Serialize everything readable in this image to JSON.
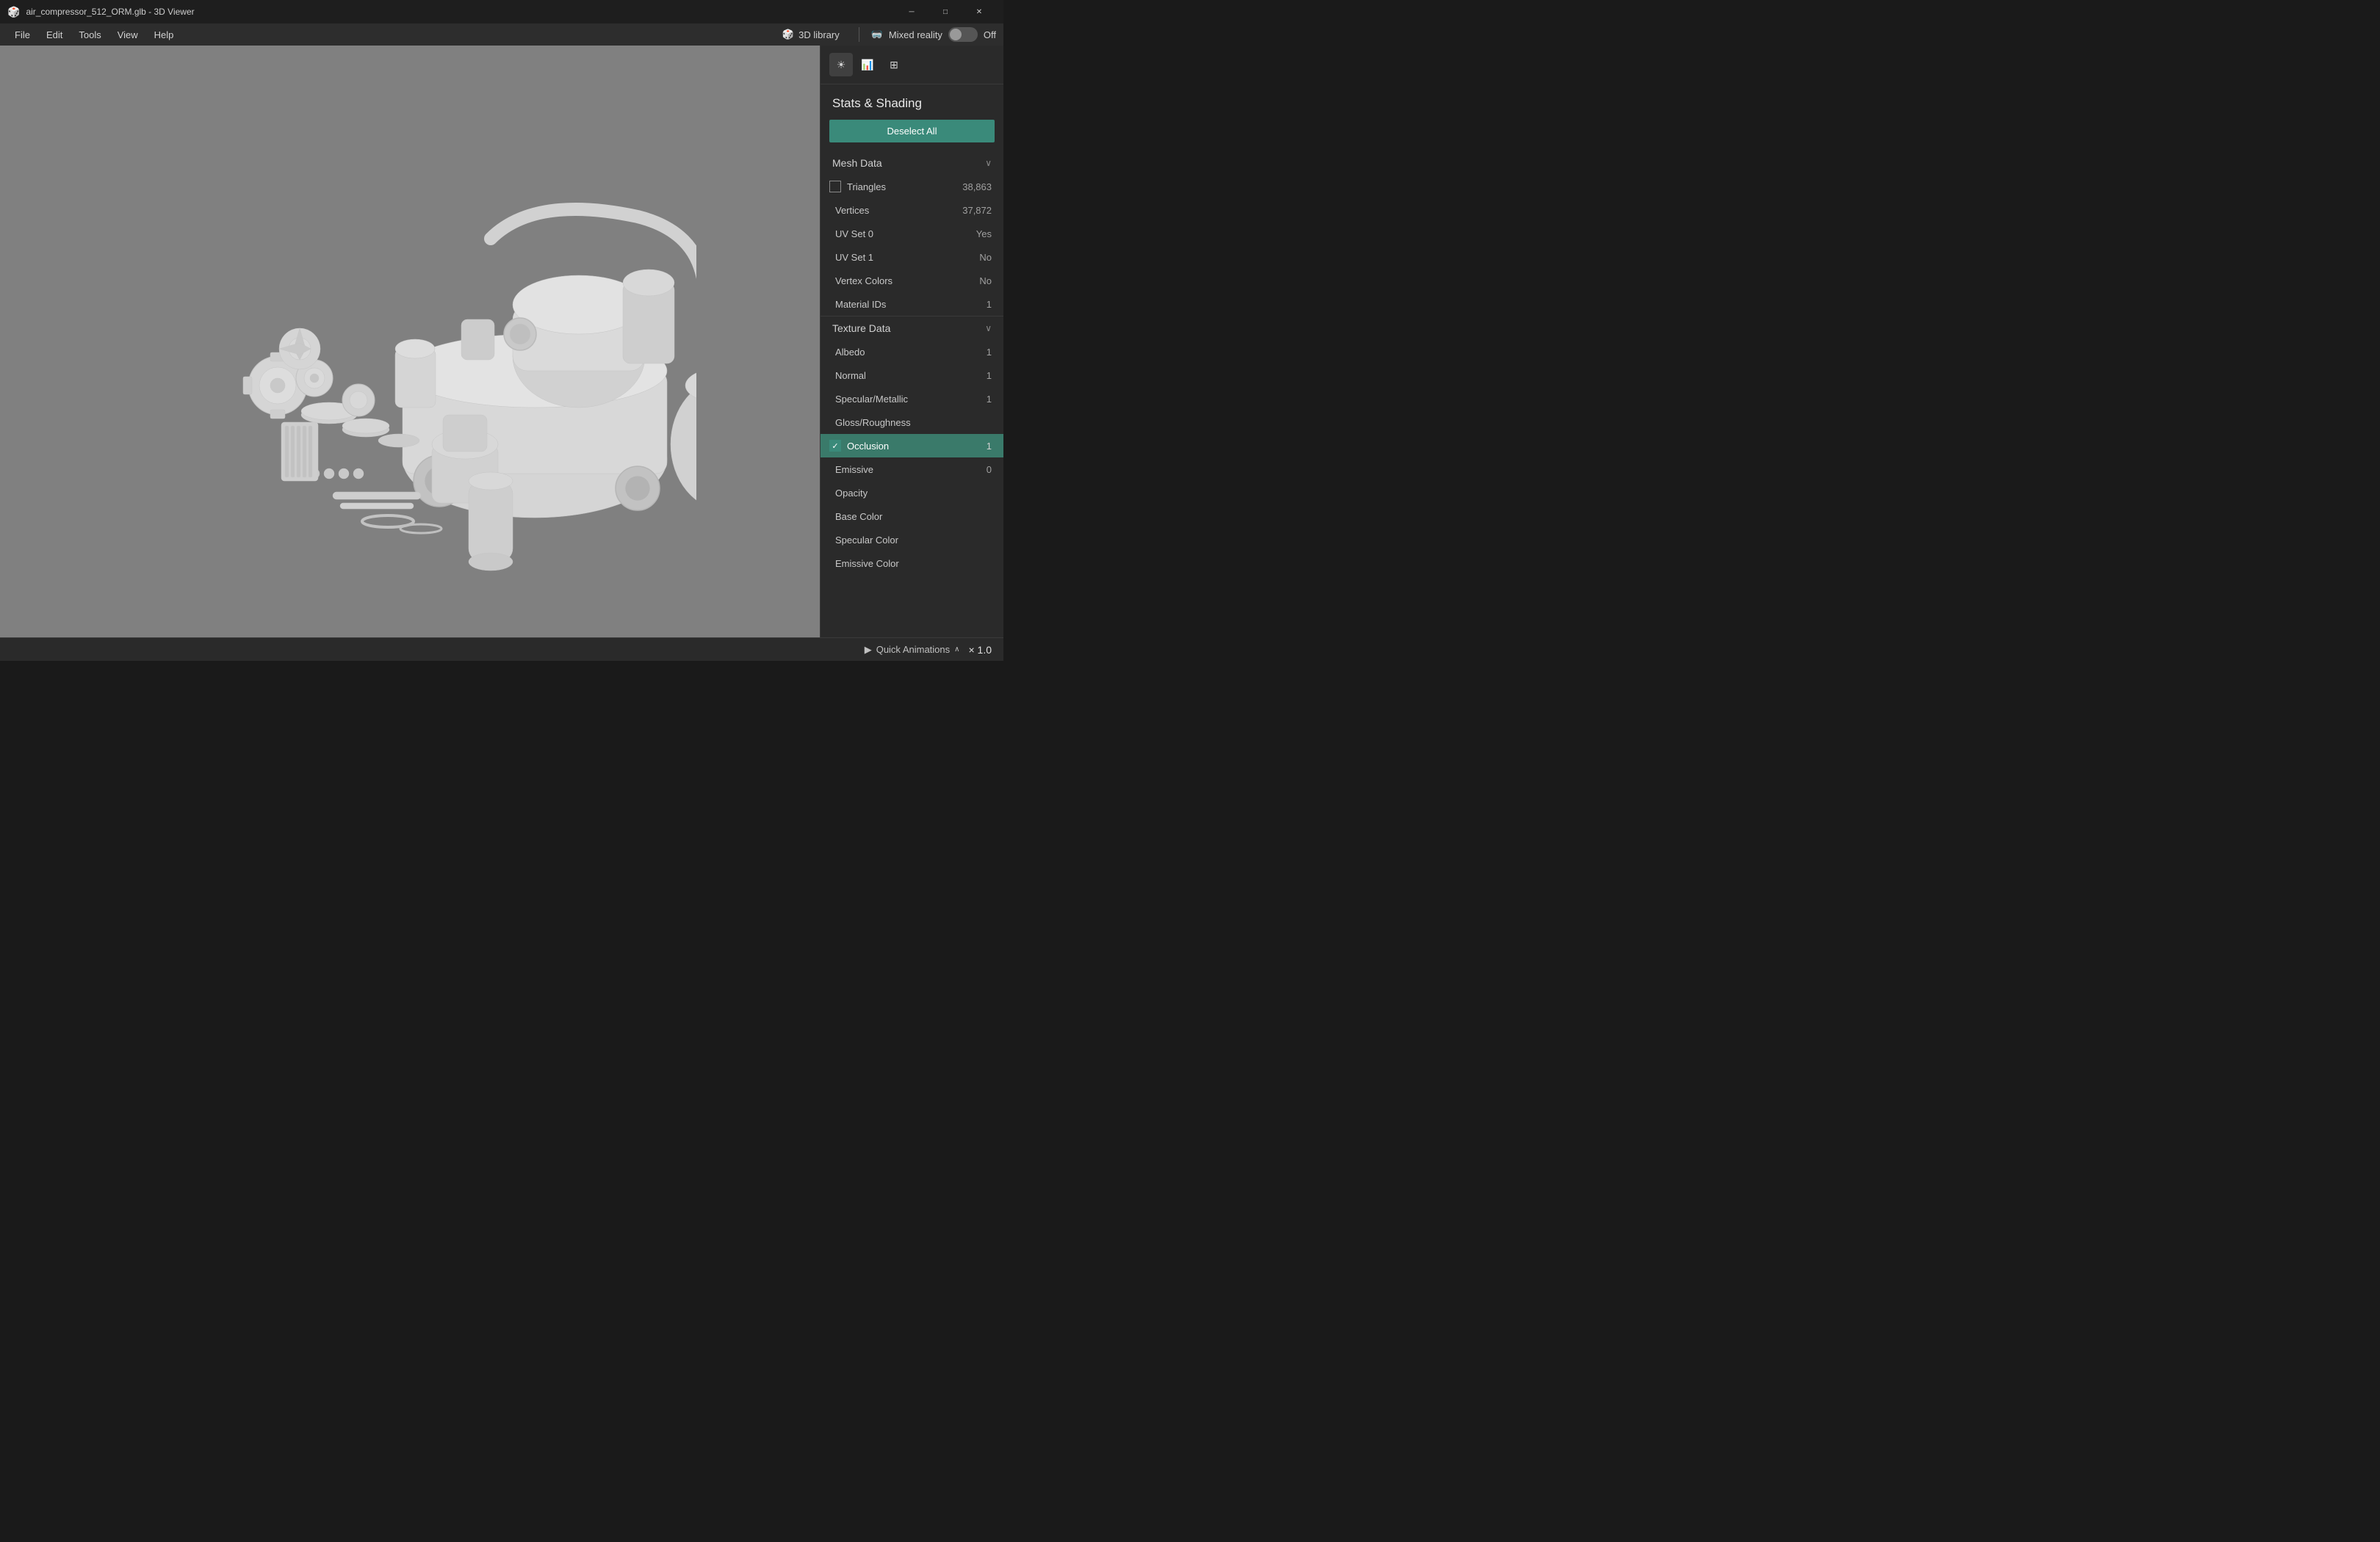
{
  "titlebar": {
    "title": "air_compressor_512_ORM.glb - 3D Viewer",
    "controls": {
      "minimize": "─",
      "maximize": "□",
      "close": "✕"
    }
  },
  "menubar": {
    "items": [
      "File",
      "Edit",
      "Tools",
      "View",
      "Help"
    ],
    "toolbar": {
      "library_label": "3D library",
      "mixed_reality_label": "Mixed reality",
      "off_label": "Off"
    }
  },
  "panel": {
    "toolbar_icons": [
      "☀",
      "📊",
      "⊞"
    ],
    "title": "Stats & Shading",
    "deselect_all_label": "Deselect All",
    "mesh_data": {
      "section_label": "Mesh Data",
      "rows": [
        {
          "label": "Triangles",
          "value": "38,863",
          "has_checkbox": true,
          "checked": false
        },
        {
          "label": "Vertices",
          "value": "37,872",
          "has_checkbox": false
        },
        {
          "label": "UV Set 0",
          "value": "Yes",
          "has_checkbox": false
        },
        {
          "label": "UV Set 1",
          "value": "No",
          "has_checkbox": false
        },
        {
          "label": "Vertex Colors",
          "value": "No",
          "has_checkbox": false
        },
        {
          "label": "Material IDs",
          "value": "1",
          "has_checkbox": false
        }
      ]
    },
    "texture_data": {
      "section_label": "Texture Data",
      "rows": [
        {
          "label": "Albedo",
          "value": "1",
          "has_checkbox": false,
          "selected": false
        },
        {
          "label": "Normal",
          "value": "1",
          "has_checkbox": false,
          "selected": false
        },
        {
          "label": "Specular/Metallic",
          "value": "1",
          "has_checkbox": false,
          "selected": false
        },
        {
          "label": "Gloss/Roughness",
          "value": "",
          "has_checkbox": false,
          "selected": false
        },
        {
          "label": "Occlusion",
          "value": "1",
          "has_checkbox": true,
          "checked": true,
          "selected": true
        },
        {
          "label": "Emissive",
          "value": "0",
          "has_checkbox": false,
          "selected": false
        },
        {
          "label": "Opacity",
          "value": "",
          "has_checkbox": false,
          "selected": false
        },
        {
          "label": "Base Color",
          "value": "",
          "has_checkbox": false,
          "selected": false
        },
        {
          "label": "Specular Color",
          "value": "",
          "has_checkbox": false,
          "selected": false
        },
        {
          "label": "Emissive Color",
          "value": "",
          "has_checkbox": false,
          "selected": false
        }
      ]
    }
  },
  "bottombar": {
    "animations_label": "Quick Animations",
    "zoom_label": "× 1.0"
  }
}
